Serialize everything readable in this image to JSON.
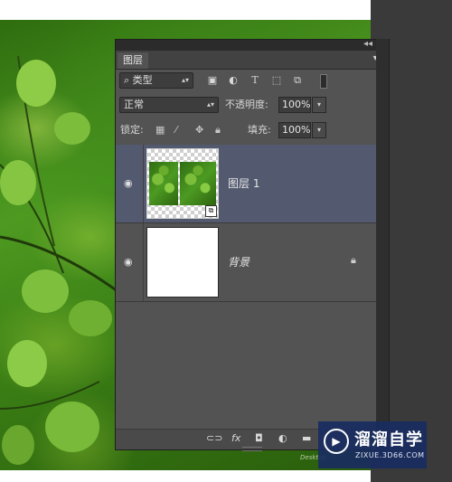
{
  "panel": {
    "tab_label": "图层",
    "collapse_icon": "double-chevron-icon",
    "close_icon": "close-icon",
    "menu_icon": "panel-menu-icon"
  },
  "filter_row": {
    "filter_kind": "类型",
    "filter_icons": [
      "image-filter-icon",
      "adjustment-filter-icon",
      "text-filter-icon",
      "shape-filter-icon",
      "smart-object-filter-icon"
    ]
  },
  "blend_row": {
    "blend_mode": "正常",
    "opacity_label": "不透明度:",
    "opacity_value": "100%"
  },
  "lock_row": {
    "lock_label": "锁定:",
    "lock_icons": [
      "lock-transparent-icon",
      "lock-brush-icon",
      "lock-move-icon",
      "lock-all-icon"
    ],
    "fill_label": "填充:",
    "fill_value": "100%"
  },
  "layers": [
    {
      "name": "图层 1",
      "selected": true,
      "visible": true,
      "smart_object": true
    },
    {
      "name": "背景",
      "selected": false,
      "visible": true,
      "locked": true
    }
  ],
  "bottom_icons": [
    "link-icon",
    "fx-icon",
    "mask-icon",
    "adjustment-layer-icon",
    "group-folder-icon"
  ],
  "bottom_fx_label": "fx",
  "watermark": {
    "title": "溜溜自学",
    "subtitle": "ZIXUE.3D66.COM",
    "corner_text": "Desktop"
  },
  "colors": {
    "panel_bg": "#535353",
    "selected_layer": "#535a6f",
    "watermark_bg": "#192d5f"
  }
}
